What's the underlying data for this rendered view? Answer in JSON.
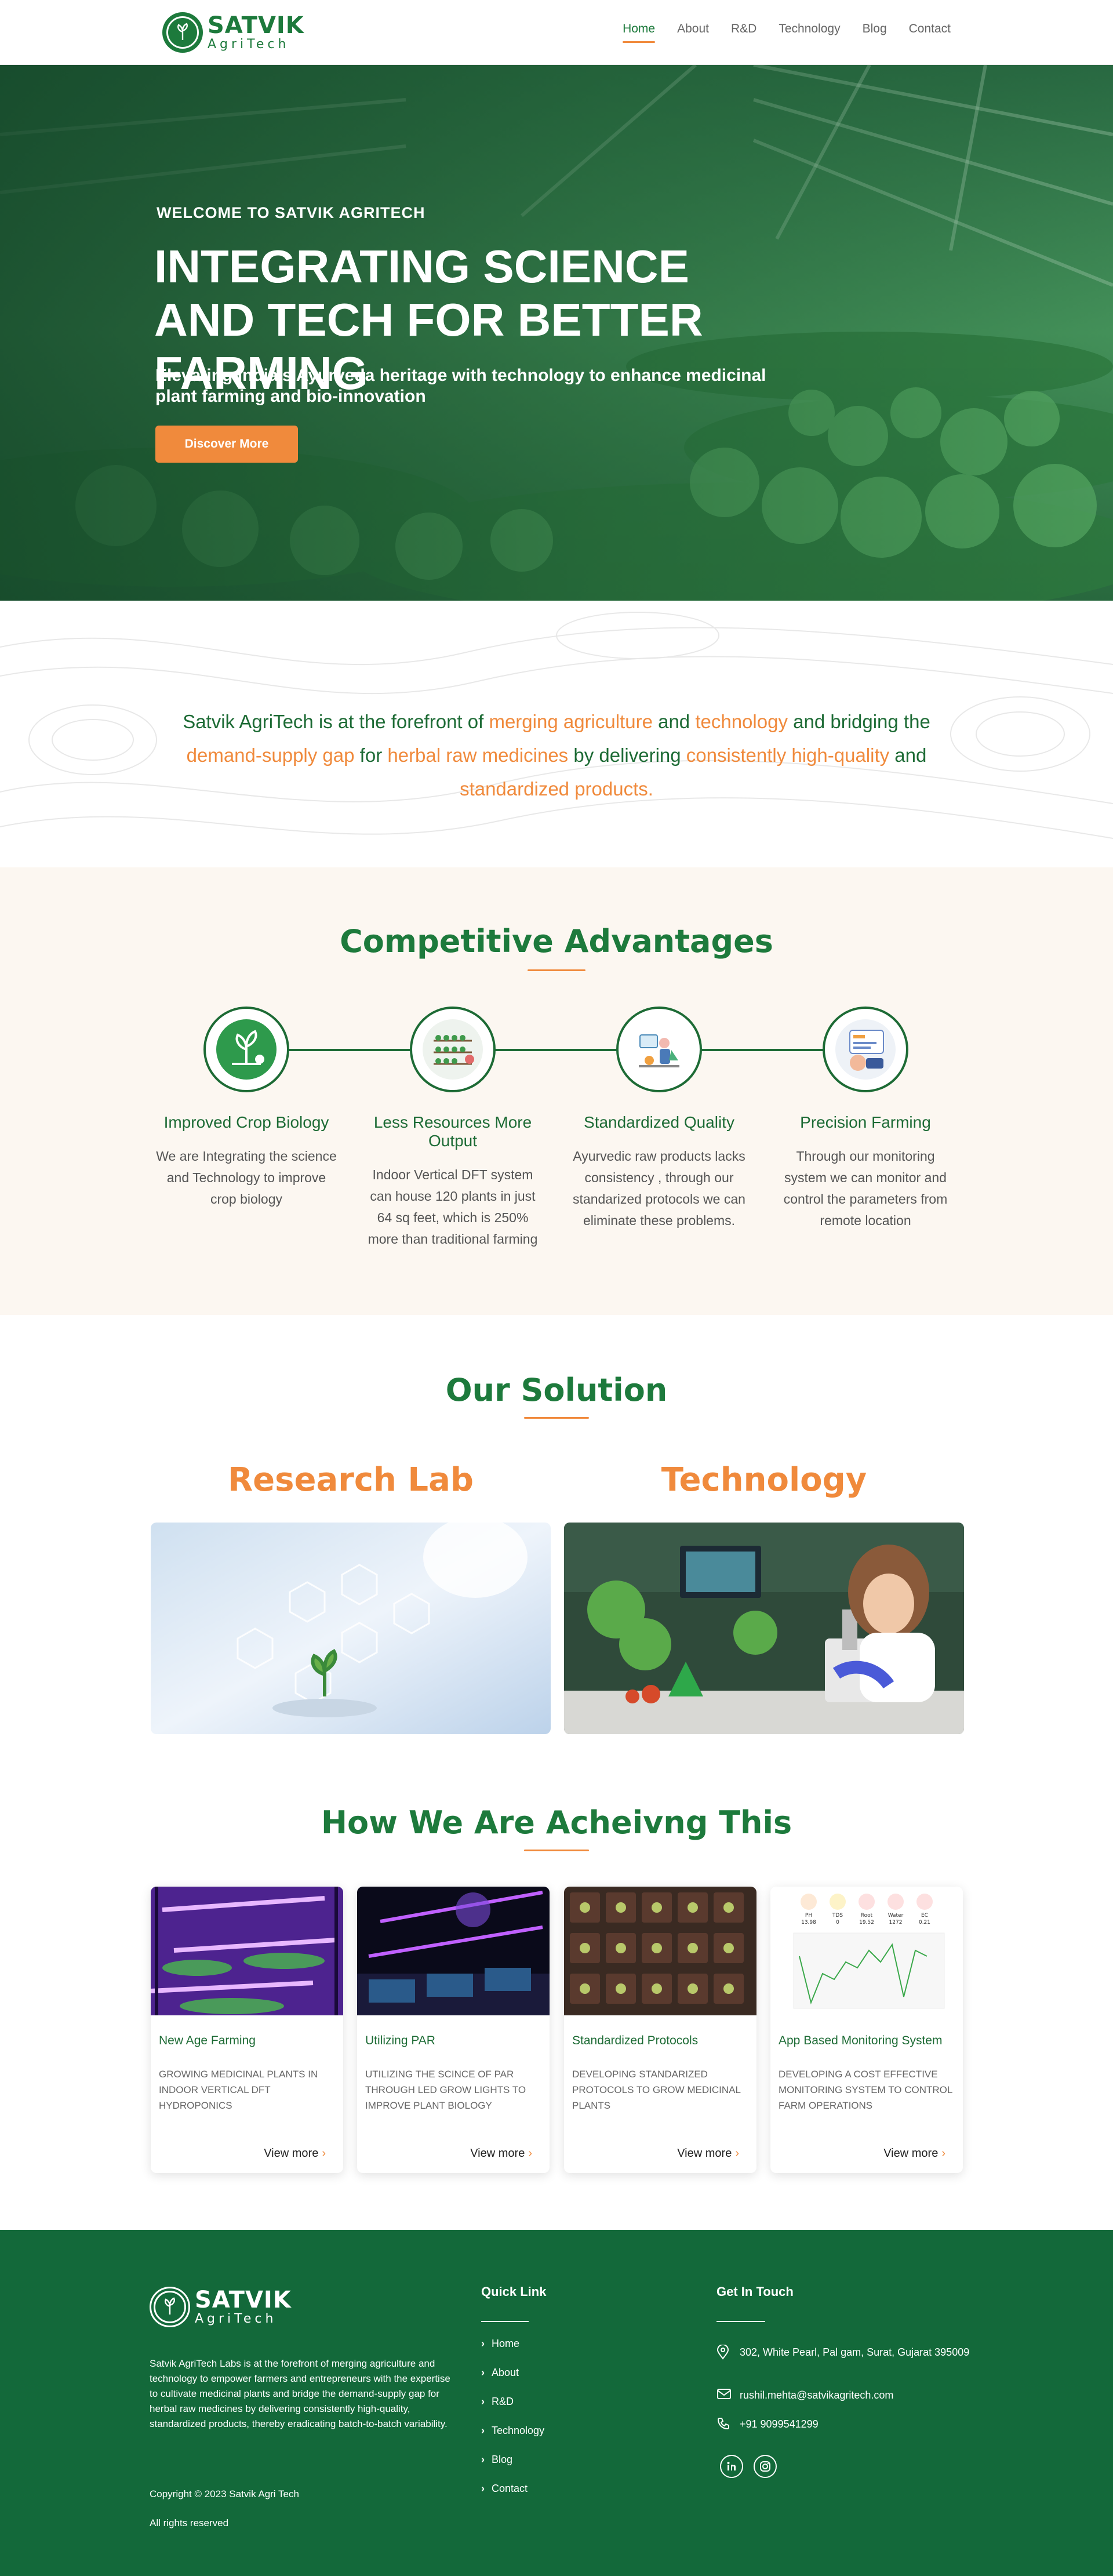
{
  "brand": {
    "name": "SATVIK",
    "sub": "AgriTech"
  },
  "nav": [
    {
      "label": "Home",
      "active": true
    },
    {
      "label": "About"
    },
    {
      "label": "R&D"
    },
    {
      "label": "Technology"
    },
    {
      "label": "Blog"
    },
    {
      "label": "Contact"
    }
  ],
  "hero": {
    "kicker": "WELCOME TO SATVIK AGRITECH",
    "title": "INTEGRATING SCIENCE AND TECH FOR BETTER FARMING",
    "subtitle": "Elevating India's Ayurveda heritage with technology to enhance medicinal plant farming and bio-innovation",
    "cta": "Discover More"
  },
  "intro": {
    "p1": "Satvik AgriTech is at the forefront of ",
    "h1": "merging agriculture",
    "p2": " and ",
    "h2": "technology",
    "p3": " and bridging the ",
    "h3": "demand-supply gap",
    "p4": " for ",
    "h4": "herbal raw medicines",
    "p5": " by delivering ",
    "h5": "consistently high-quality",
    "p6": " and ",
    "h6": "standardized products."
  },
  "advantages": {
    "title": "Competitive Advantages",
    "items": [
      {
        "title": "Improved Crop Biology",
        "desc": "We are Integrating the science and Technology to improve crop biology"
      },
      {
        "title": "Less Resources More Output",
        "desc": "Indoor Vertical DFT system can house 120 plants in just 64 sq feet, which is 250% more than traditional farming"
      },
      {
        "title": "Standardized Quality",
        "desc": "Ayurvedic raw products lacks consistency , through our standarized protocols we can eliminate these problems."
      },
      {
        "title": "Precision Farming",
        "desc": "Through our monitoring system we can monitor and control the parameters from remote location"
      }
    ]
  },
  "solution": {
    "title": "Our Solution",
    "left": "Research Lab",
    "right": "Technology"
  },
  "achieving": {
    "title": "How We Are Acheivng This",
    "more": "View more",
    "cards": [
      {
        "title": "New Age Farming",
        "desc": "GROWING MEDICINAL PLANTS IN INDOOR VERTICAL DFT HYDROPONICS"
      },
      {
        "title": "Utilizing PAR",
        "desc": "UTILIZING THE SCINCE OF PAR THROUGH LED GROW LIGHTS TO IMPROVE PLANT BIOLOGY"
      },
      {
        "title": "Standardized Protocols",
        "desc": "DEVELOPING STANDARIZED PROTOCOLS TO GROW MEDICINAL PLANTS"
      },
      {
        "title": "App Based Monitoring System",
        "desc": "DEVELOPING A COST EFFECTIVE MONITORING SYSTEM TO CONTROL FARM OPERATIONS"
      }
    ],
    "monitor": {
      "labels": [
        "PH",
        "TDS",
        "Root",
        "Water",
        "EC"
      ],
      "values": [
        "13.98",
        "0",
        "19.52",
        "1272",
        "0.21"
      ]
    }
  },
  "footer": {
    "about": "Satvik AgriTech Labs is at the forefront of merging agriculture and technology to empower farmers and entrepreneurs with the expertise to cultivate medicinal plants and bridge the demand-supply gap for herbal raw medicines by delivering consistently high-quality, standardized products, thereby eradicating batch-to-batch variability.",
    "copyright": "Copyright © 2023 Satvik Agri Tech",
    "rights": "All rights reserved",
    "quick_title": "Quick Link",
    "links": [
      "Home",
      "About",
      "R&D",
      "Technology",
      "Blog",
      "Contact"
    ],
    "contact_title": "Get In Touch",
    "address": "302, White Pearl, Pal gam, Surat, Gujarat 395009",
    "email": "rushil.mehta@satvikagritech.com",
    "phone": "+91 9099541299"
  },
  "colors": {
    "green": "#1d7a3c",
    "dark_green": "#13693a",
    "orange": "#f08a3c",
    "cream": "#fcf7f1"
  }
}
